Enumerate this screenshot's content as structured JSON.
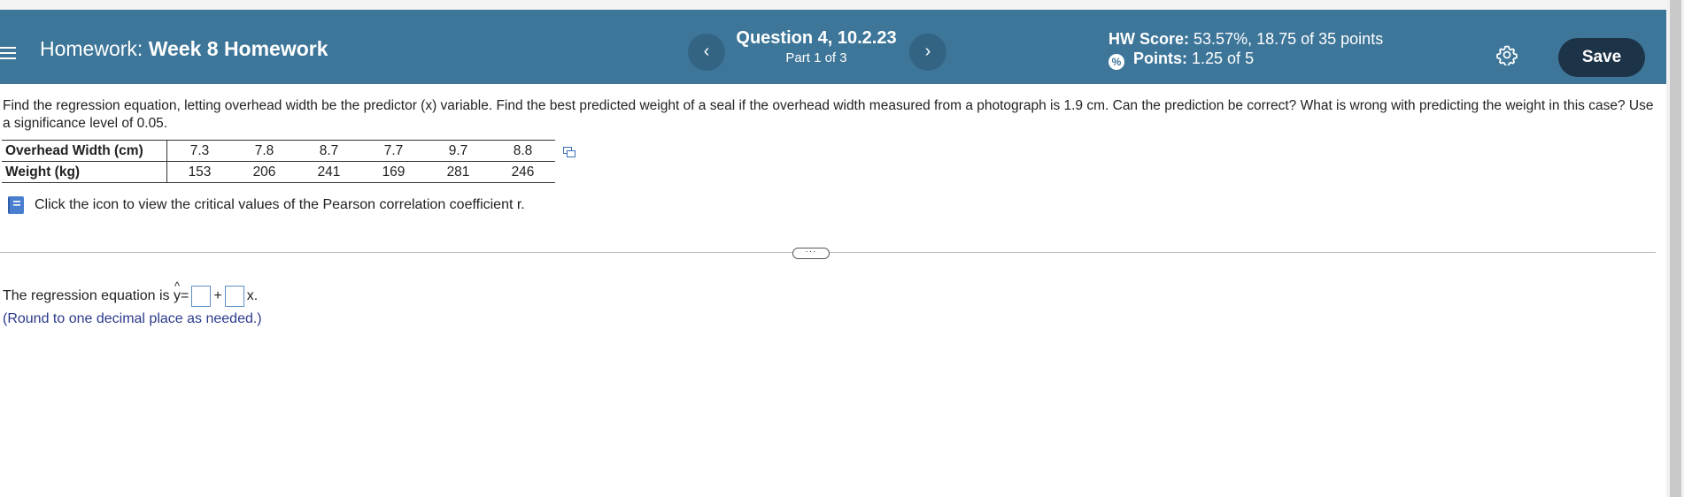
{
  "header": {
    "homework_prefix": "Homework:",
    "homework_name": "Week 8 Homework",
    "question_title": "Question 4, 10.2.23",
    "question_part": "Part 1 of 3",
    "hw_score_label": "HW Score:",
    "hw_score_value": "53.57%, 18.75 of 35 points",
    "points_label": "Points:",
    "points_value": "1.25 of 5",
    "save_label": "Save",
    "prev_symbol": "‹",
    "next_symbol": "›"
  },
  "problem": {
    "text": "Find the regression equation, letting overhead width be the predictor (x) variable. Find the best predicted weight of a seal if the overhead width measured from a photograph is 1.9 cm. Can the prediction be correct? What is wrong with predicting the weight in this case? Use a significance level of 0.05."
  },
  "table": {
    "rows": [
      {
        "label": "Overhead Width (cm)",
        "values": [
          "7.3",
          "7.8",
          "8.7",
          "7.7",
          "9.7",
          "8.8"
        ]
      },
      {
        "label": "Weight (kg)",
        "values": [
          "153",
          "206",
          "241",
          "169",
          "281",
          "246"
        ]
      }
    ]
  },
  "info_link": "Click the icon to view the critical values of the Pearson correlation coefficient r.",
  "answer": {
    "prefix": "The regression equation is",
    "yhat": "y",
    "equals": "=",
    "plus": "+",
    "x_suffix": "x.",
    "note": "(Round to one decimal place as needed.)"
  },
  "colors": {
    "header_bg": "#3d7699",
    "save_bg": "#1d3347",
    "note_color": "#2b3a8c"
  }
}
